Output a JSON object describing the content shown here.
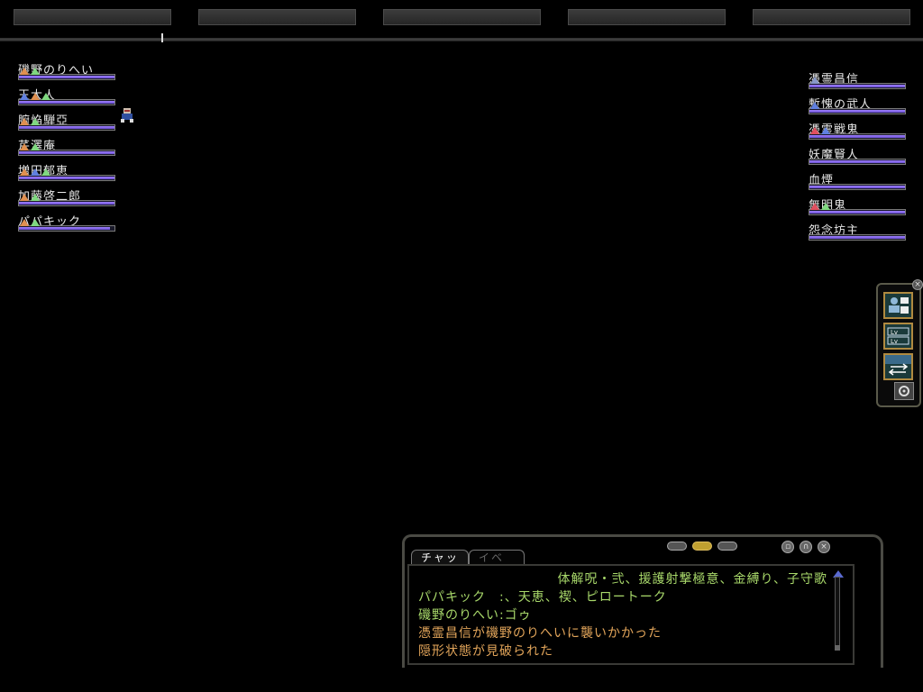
{
  "allies": [
    {
      "name": "磯野のりへい",
      "hp_pct": 100,
      "icons": [
        "orange",
        "green"
      ]
    },
    {
      "name": "王大人",
      "hp_pct": 100,
      "icons": [
        "blue",
        "orange",
        "green"
      ]
    },
    {
      "name": "腑焔騨亞",
      "hp_pct": 100,
      "icons": [
        "orange",
        "green"
      ]
    },
    {
      "name": "芹澤庵",
      "hp_pct": 100,
      "icons": [
        "orange",
        "green"
      ]
    },
    {
      "name": "増田郁恵",
      "hp_pct": 100,
      "icons": [
        "orange",
        "blue",
        "green"
      ]
    },
    {
      "name": "加藤啓二郎",
      "hp_pct": 100,
      "icons": [
        "orange",
        "green"
      ]
    },
    {
      "name": "パパキック",
      "hp_pct": 95,
      "icons": [
        "orange",
        "green"
      ]
    }
  ],
  "enemies": [
    {
      "name": "憑霊昌信",
      "hp_pct": 100,
      "icons": [
        "grey"
      ]
    },
    {
      "name": "慙愧の武人",
      "hp_pct": 100,
      "icons": [
        "blue"
      ]
    },
    {
      "name": "憑霊戦鬼",
      "hp_pct": 100,
      "icons": [
        "red",
        "blue"
      ]
    },
    {
      "name": "妖魔賢人",
      "hp_pct": 100,
      "icons": []
    },
    {
      "name": "血煙",
      "hp_pct": 100,
      "icons": []
    },
    {
      "name": "無明鬼",
      "hp_pct": 100,
      "icons": [
        "red",
        "green"
      ]
    },
    {
      "name": "怨念坊主",
      "hp_pct": 100,
      "icons": []
    }
  ],
  "chat": {
    "tabs": [
      "チャット",
      "イベント"
    ],
    "active_tab": 0,
    "lines": [
      {
        "text": "体解呪・弐、援護射撃極意、金縛り、子守歌",
        "color": "green"
      },
      {
        "text": "パパキック　:、天恵、禊、ピロートーク",
        "color": "green"
      },
      {
        "text": "磯野のりへい:ゴゥ",
        "color": "green"
      },
      {
        "text": "憑霊昌信が磯野のりへいに襲いかかった",
        "color": "orange"
      },
      {
        "text": "隠形状態が見破られた",
        "color": "orange"
      }
    ]
  },
  "side_menu": {
    "buttons": [
      "character-status-icon",
      "level-icon",
      "swap-icon",
      "settings-icon"
    ],
    "level_labels": [
      "Lv",
      "Lv"
    ]
  },
  "colors": {
    "hp_bar": "#8a6af0",
    "chat_green": "#a8d86a",
    "chat_orange": "#e2a55a"
  }
}
